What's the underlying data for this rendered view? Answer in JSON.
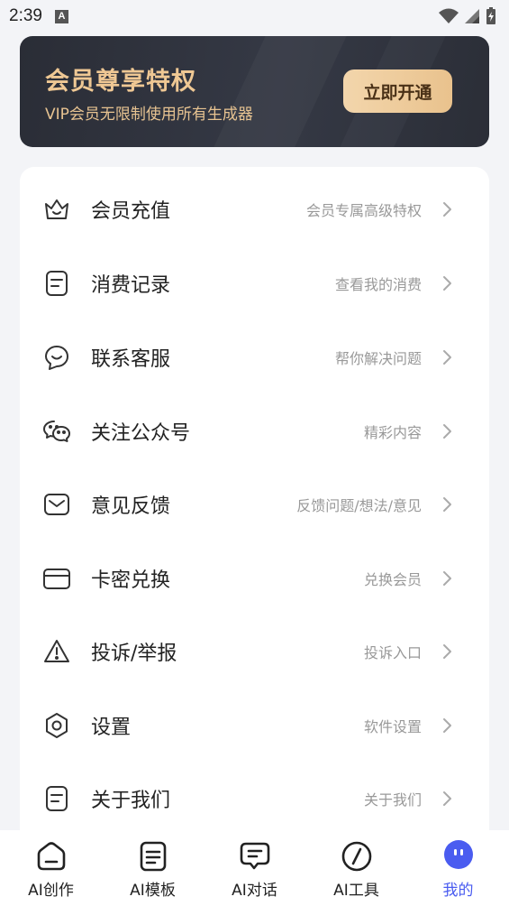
{
  "status_bar": {
    "time": "2:39",
    "notification_glyph": "A"
  },
  "vip_banner": {
    "title": "会员尊享特权",
    "subtitle": "VIP会员无限制使用所有生成器",
    "button_label": "立即开通"
  },
  "menu": {
    "items": [
      {
        "label": "会员充值",
        "hint": "会员专属高级特权",
        "icon": "crown-icon"
      },
      {
        "label": "消费记录",
        "hint": "查看我的消费",
        "icon": "receipt-icon"
      },
      {
        "label": "联系客服",
        "hint": "帮你解决问题",
        "icon": "smile-chat-icon"
      },
      {
        "label": "关注公众号",
        "hint": "精彩内容",
        "icon": "wechat-icon"
      },
      {
        "label": "意见反馈",
        "hint": "反馈问题/想法/意见",
        "icon": "mail-icon"
      },
      {
        "label": "卡密兑换",
        "hint": "兑换会员",
        "icon": "card-icon"
      },
      {
        "label": "投诉/举报",
        "hint": "投诉入口",
        "icon": "warning-icon"
      },
      {
        "label": "设置",
        "hint": "软件设置",
        "icon": "settings-icon"
      },
      {
        "label": "关于我们",
        "hint": "关于我们",
        "icon": "document-icon"
      }
    ]
  },
  "bottom_nav": {
    "items": [
      {
        "label": "AI创作",
        "icon": "home-icon",
        "active": false
      },
      {
        "label": "AI模板",
        "icon": "template-icon",
        "active": false
      },
      {
        "label": "AI对话",
        "icon": "chat-icon",
        "active": false
      },
      {
        "label": "AI工具",
        "icon": "compass-icon",
        "active": false
      },
      {
        "label": "我的",
        "icon": "profile-face-icon",
        "active": true
      }
    ]
  },
  "colors": {
    "accent": "#4a5cf0",
    "vip_gold": "#efc894",
    "banner_bg": "#2f323c",
    "page_bg": "#f3f4f7"
  }
}
